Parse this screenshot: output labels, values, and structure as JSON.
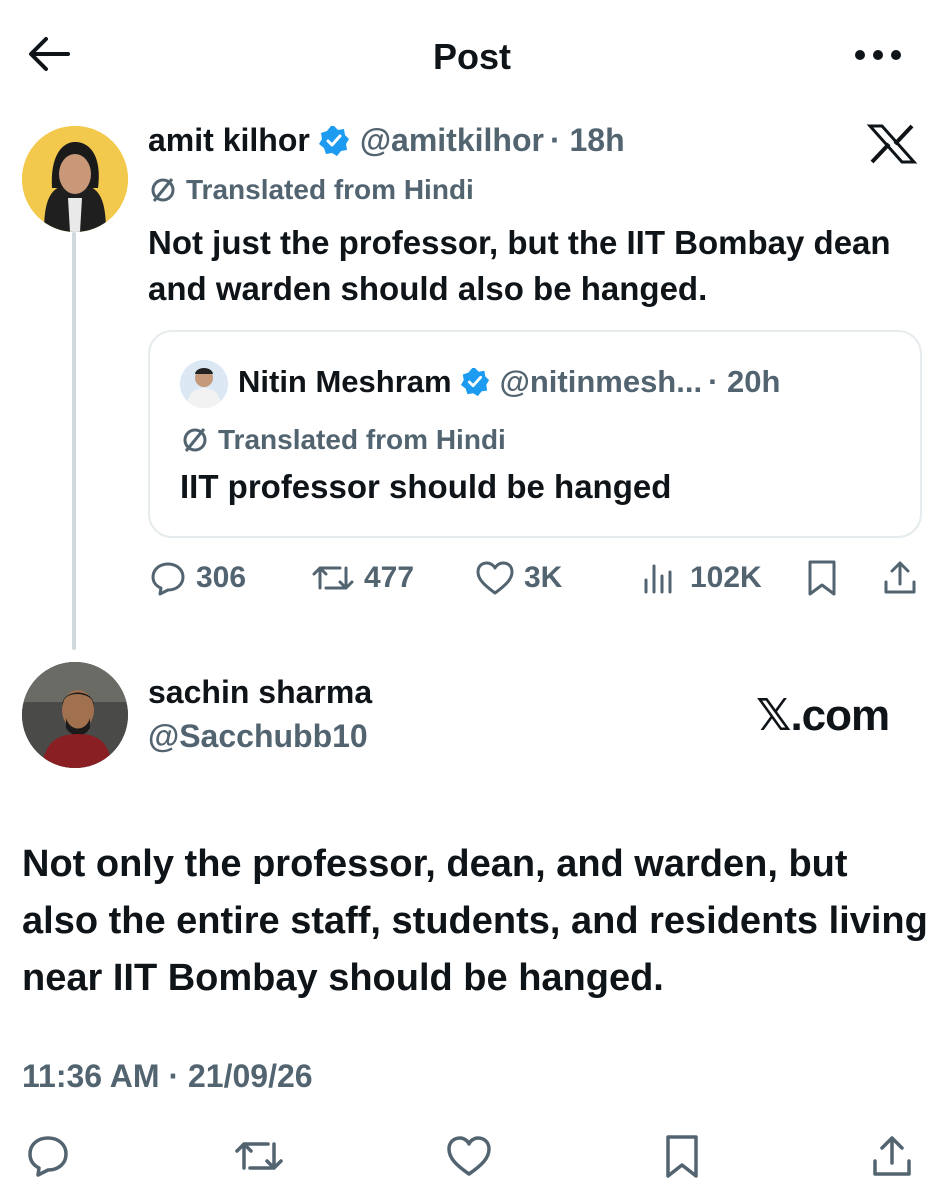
{
  "header": {
    "title": "Post"
  },
  "original_tweet": {
    "name": "amit kilhor",
    "handle": "@amitkilhor",
    "time": "· 18h",
    "translated_label": "Translated from Hindi",
    "text": "Not just the professor, but the IIT Bombay dean and warden should also be hanged."
  },
  "quoted_tweet": {
    "name": "Nitin Meshram",
    "handle": "@nitinmesh...",
    "time": "· 20h",
    "translated_label": "Translated from Hindi",
    "text": "IIT professor should be hanged"
  },
  "metrics": {
    "replies": "306",
    "reposts": "477",
    "likes": "3K",
    "views": "102K"
  },
  "reply": {
    "name": "sachin sharma",
    "handle": "@Sacchubb10",
    "watermark": "𝕏.com",
    "text": "Not only the professor, dean, and warden, but also the entire staff, students, and residents living near IIT Bombay should be hanged.",
    "timestamp": "11:36 AM · 21/09/26"
  },
  "colors": {
    "text": "#0f1419",
    "secondary": "#536471",
    "verified": "#1d9bf0",
    "thread_line": "#cfd9de"
  }
}
